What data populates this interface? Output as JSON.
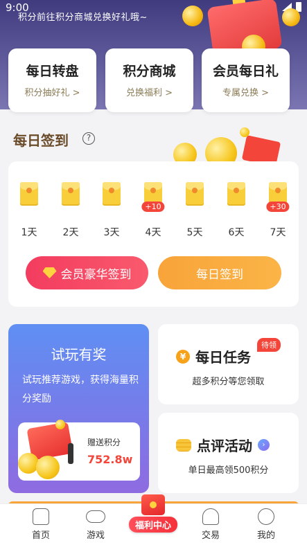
{
  "status_bar": {
    "time": "9:00"
  },
  "hero": {
    "text": "积分前往积分商城兑换好礼哦~"
  },
  "quick_links": [
    {
      "title": "每日转盘",
      "subtitle": "积分抽好礼 >"
    },
    {
      "title": "积分商城",
      "subtitle": "兑换福利 >"
    },
    {
      "title": "会员每日礼",
      "subtitle": "专属兑换 >"
    }
  ],
  "signin": {
    "title": "每日签到",
    "help_symbol": "?",
    "days": [
      {
        "label": "1天",
        "bonus": ""
      },
      {
        "label": "2天",
        "bonus": ""
      },
      {
        "label": "3天",
        "bonus": ""
      },
      {
        "label": "4天",
        "bonus": "+10"
      },
      {
        "label": "5天",
        "bonus": ""
      },
      {
        "label": "6天",
        "bonus": ""
      },
      {
        "label": "7天",
        "bonus": "+30"
      }
    ],
    "vip_button": "会员豪华签到",
    "daily_button": "每日签到"
  },
  "trial": {
    "title": "试玩有奖",
    "description": "试玩推荐游戏，获得海量积分奖励",
    "gift_label": "赠送积分",
    "gift_value": "752.8w"
  },
  "tasks": [
    {
      "title": "每日任务",
      "badge": "待领",
      "subtitle": "超多积分等您领取",
      "icon": "yen-coin-icon",
      "icon_glyph": "¥"
    },
    {
      "title": "点评活动",
      "badge": "",
      "subtitle": "单日最高领500积分",
      "icon": "coin-stack-icon",
      "icon_glyph": "›"
    }
  ],
  "bottom_nav": {
    "items": [
      "首页",
      "游戏",
      "福利中心",
      "交易",
      "我的"
    ],
    "active": "福利中心"
  },
  "colors": {
    "accent_red": "#f4453a",
    "accent_orange": "#f8a43a",
    "hero_bg": "#4a4588",
    "brown_title": "#6a4b2a"
  }
}
